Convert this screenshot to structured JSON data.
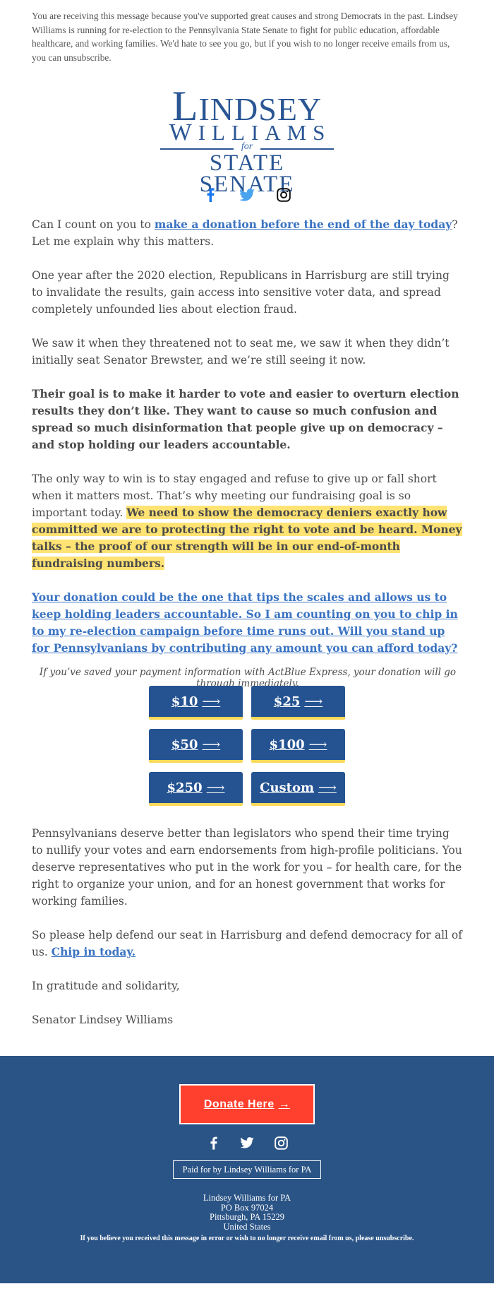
{
  "preheader": {
    "text": "You are receiving this message because you've supported great causes and strong Democrats in the past. Lindsey Williams is running for re-election to the Pennsylvania State Senate to fight for public education, affordable healthcare, and working families. We'd hate to see you go, but if you wish to no longer receive emails from us, you can ",
    "unsubscribe_link": "unsubscribe",
    "end": "."
  },
  "logo": {
    "line1": "Lindsey",
    "line2": "Williams",
    "for": "for",
    "line3": "State Senate"
  },
  "social_top": [
    {
      "icon": "facebook-icon",
      "color": "#1877f2"
    },
    {
      "icon": "twitter-icon",
      "color": "#4aa3ee"
    },
    {
      "icon": "instagram-icon",
      "color": "#111111"
    }
  ],
  "body": {
    "p1_before": "Can I count on you to ",
    "p1_link": "make a donation before the end of the day today",
    "p1_after": "? Let me explain why this matters.",
    "p2": "One year after the 2020 election, Republicans in Harrisburg are still trying to invalidate the results, gain access into sensitive voter data, and spread completely unfounded lies about election fraud.",
    "p3": "We saw it when they threatened not to seat me, we saw it when they didn’t initially seat Senator Brewster, and we’re still seeing it now.",
    "p4": "Their goal is to make it harder to vote and easier to overturn election results they don’t like. They want to cause so much confusion and spread so much disinformation that people give up on democracy – and stop holding our leaders accountable.",
    "p5_plain": "The only way to win is to stay engaged and refuse to give up or fall short when it matters most. That’s why meeting our fundraising goal is so important today. ",
    "p5_highlight": "We need to show the democracy deniers exactly how committed we are to protecting the right to vote and be heard. Money talks – the proof of our strength will be in our end-of-month fundraising numbers.",
    "p6_link": "Your donation could be the one that tips the scales and allows us to keep holding leaders accountable. So I am counting on you to chip in to my re-election campaign before time runs out. Will you stand up for Pennsylvanians by contributing any amount you can afford today?",
    "note": "If you’ve saved your payment information with ActBlue Express, your donation will go through immediately."
  },
  "donate_buttons": [
    {
      "label": "$10",
      "arrow": "⟶"
    },
    {
      "label": "$25",
      "arrow": "⟶"
    },
    {
      "label": "$50",
      "arrow": "⟶"
    },
    {
      "label": "$100",
      "arrow": "⟶"
    },
    {
      "label": "$250",
      "arrow": "⟶"
    },
    {
      "label": "Custom",
      "arrow": "⟶"
    }
  ],
  "body2": {
    "p7": "Pennsylvanians deserve better than legislators who spend their time trying to nullify your votes and earn endorsements from high-profile politicians. You deserve representatives who put in the work for you – for health care, for the right to organize your union, and for an honest government that works for working families.",
    "p8_before": "So please help defend our seat in Harrisburg and defend democracy for all of us. ",
    "p8_link": "Chip in today.",
    "closing": "In gratitude and solidarity,",
    "signature": "Senator Lindsey Williams"
  },
  "footer": {
    "donate_label": "Donate Here",
    "donate_arrow": "→",
    "paid_for": "Paid for by Lindsey Williams for PA",
    "address": [
      "Lindsey Williams for PA",
      "PO Box 97024",
      "Pittsburgh, PA 15229",
      "United States"
    ],
    "unsub_text": "If you believe you received this message in error or wish to no longer receive email from us, please ",
    "unsub_link": "unsubscribe",
    "unsub_end": ".",
    "colors": {
      "background": "#2b5486",
      "donate": "#ff402e"
    }
  },
  "colors": {
    "link": "#3a73c2",
    "highlight": "#ffe373",
    "button": "#255391",
    "button_accent": "#fad859",
    "logo": "#2a5694"
  }
}
